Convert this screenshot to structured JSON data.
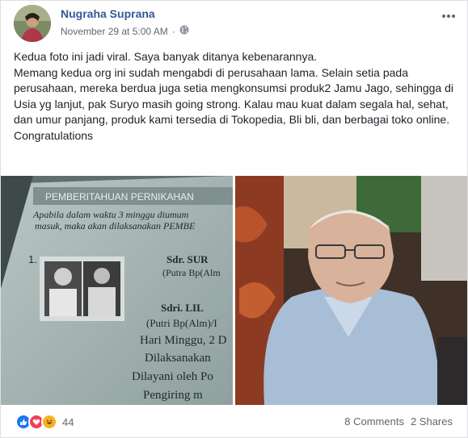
{
  "post": {
    "author": "Nugraha Suprana",
    "timestamp": "November 29 at 5:00 AM",
    "separator": "·",
    "privacy_icon": "globe-icon",
    "more_icon": "ellipsis-icon",
    "body": [
      "Kedua foto ini jadi viral. Saya banyak ditanya kebenarannya.",
      "Memang kedua org ini sudah mengabdi di perusahaan lama. Selain setia pada perusahaan, mereka berdua juga setia mengkonsumsi produk2 Jamu Jago, sehingga di Usia yg lanjut, pak Suryo masih going strong. Kalau mau kuat dalam segala hal, sehat, dan umur panjang, produk kami tersedia di Tokopedia, Bli bli, dan berbagai toko online.",
      "Congratulations"
    ]
  },
  "photo_left": {
    "header": "PEMBERITAHUAN PERNIKAHAN",
    "lines": [
      "Apabila dalam waktu 3 minggu diumum",
      "masuk, maka akan dilaksanakan PEMBE"
    ],
    "number": "1.",
    "groom_name": "Sdr. SUR",
    "groom_parent": "(Putra Bp(Alm",
    "bride_name": "Sdri. LIL",
    "bride_parent": "(Putri Bp(Alm)/I",
    "day": "Hari Minggu, 2 D",
    "held": "Dilaksanakan",
    "served": "Dilayani oleh Po",
    "escort": "Pengiring m"
  },
  "footer": {
    "reaction_count": "44",
    "comments": "8 Comments",
    "shares": "2 Shares",
    "reactions": [
      "like-icon",
      "love-icon",
      "haha-icon"
    ]
  },
  "colors": {
    "link": "#365899",
    "meta": "#616770",
    "like": "#1877f2",
    "love": "#f33e58",
    "haha": "#f7b125"
  }
}
